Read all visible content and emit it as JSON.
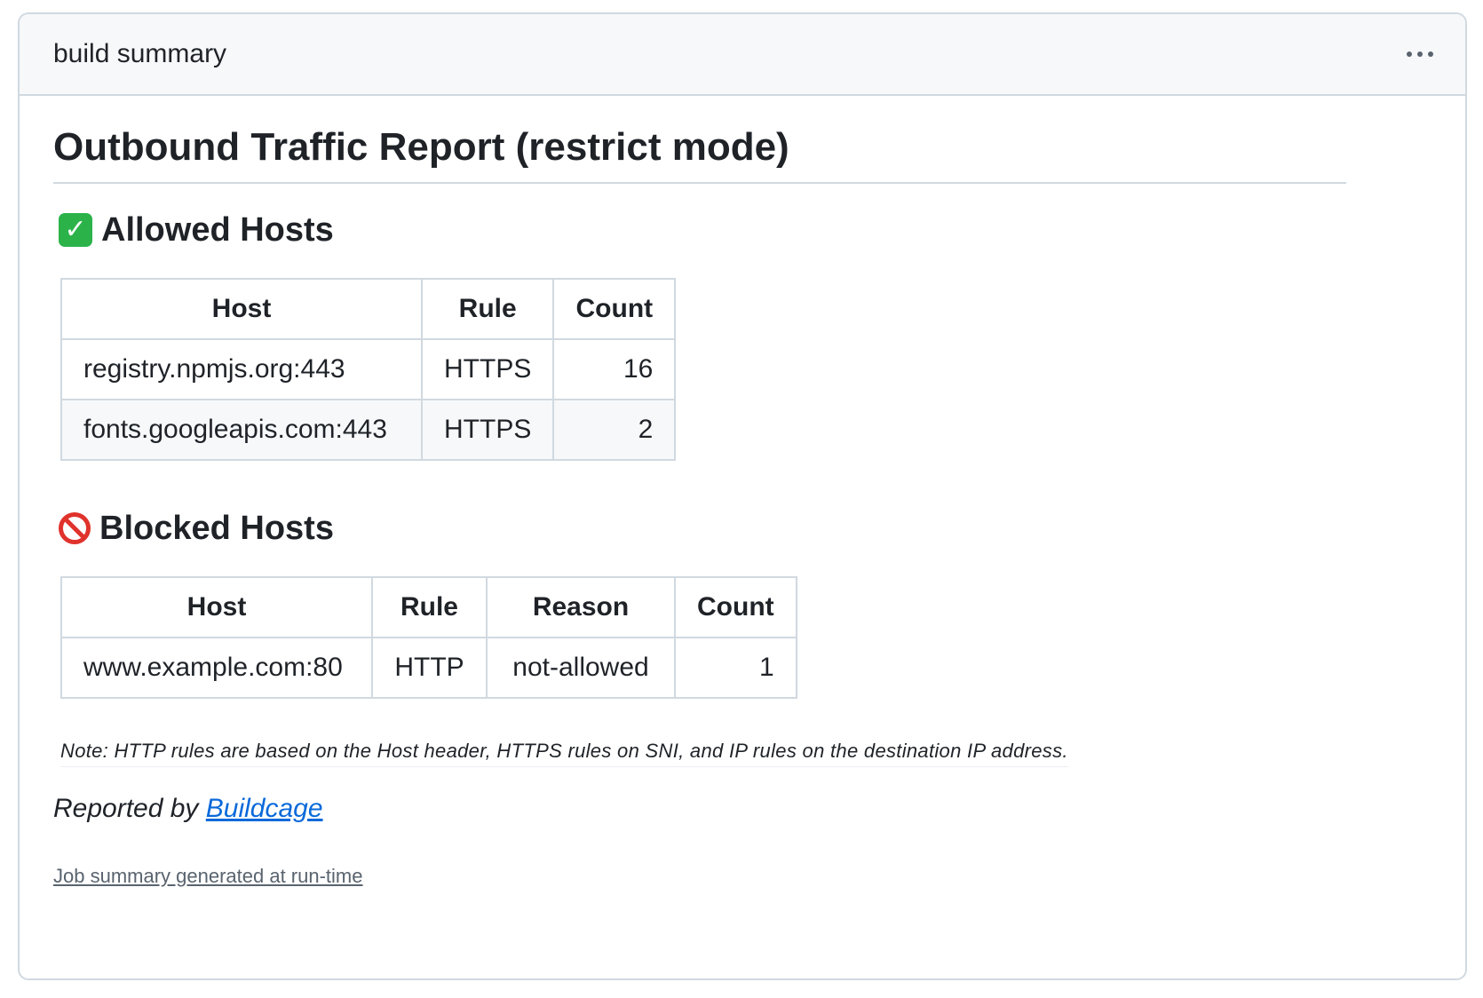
{
  "card": {
    "title": "build summary",
    "menu_icon": "kebab-horizontal-icon"
  },
  "report": {
    "title": "Outbound Traffic Report (restrict mode)"
  },
  "allowed": {
    "icon": "white-check-mark-icon",
    "heading": "Allowed Hosts",
    "columns": [
      "Host",
      "Rule",
      "Count"
    ],
    "rows": [
      {
        "host": "registry.npmjs.org:443",
        "rule": "HTTPS",
        "count": "16"
      },
      {
        "host": "fonts.googleapis.com:443",
        "rule": "HTTPS",
        "count": "2"
      }
    ]
  },
  "blocked": {
    "icon": "no-entry-sign-icon",
    "heading": "Blocked Hosts",
    "columns": [
      "Host",
      "Rule",
      "Reason",
      "Count"
    ],
    "rows": [
      {
        "host": "www.example.com:80",
        "rule": "HTTP",
        "reason": "not-allowed",
        "count": "1"
      }
    ]
  },
  "note": "Note: HTTP rules are based on the Host header, HTTPS rules on SNI, and IP rules on the destination IP address.",
  "reported": {
    "prefix": "Reported by",
    "link_text": "Buildcage"
  },
  "footer": {
    "link_text": "Job summary generated at run-time"
  },
  "colors": {
    "link": "#0969da",
    "border": "#d1d9e0",
    "header_bg": "#f6f8fa",
    "check_green": "#2bb34a",
    "block_red": "#e0322c"
  }
}
